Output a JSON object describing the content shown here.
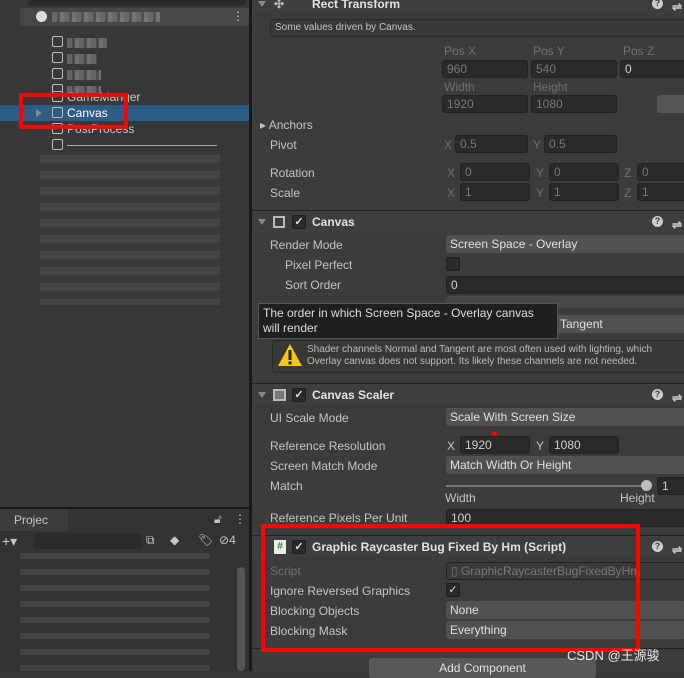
{
  "hierarchy": {
    "items": [
      {
        "label": "GameManger"
      },
      {
        "label": "Canvas",
        "selected": true
      },
      {
        "label": "PostProcess"
      }
    ],
    "menu_icon": "kebab-icon"
  },
  "project": {
    "tab_label": "Projec",
    "hidden_count": "4"
  },
  "inspector": {
    "rect_transform": {
      "title": "Rect Transform",
      "note": "Some values driven by Canvas.",
      "pos_x_label": "Pos X",
      "pos_y_label": "Pos Y",
      "pos_z_label": "Pos Z",
      "pos_x": "960",
      "pos_y": "540",
      "pos_z": "0",
      "width_label": "Width",
      "height_label": "Height",
      "width": "1920",
      "height": "1080",
      "anchors_label": "Anchors",
      "pivot_label": "Pivot",
      "pivot_x": "0.5",
      "pivot_y": "0.5",
      "rotation_label": "Rotation",
      "rot_x": "0",
      "rot_y": "0",
      "rot_z": "0",
      "scale_label": "Scale",
      "scale_x": "1",
      "scale_y": "1",
      "scale_z": "1",
      "axis_x": "X",
      "axis_y": "Y",
      "axis_z": "Z"
    },
    "canvas": {
      "title": "Canvas",
      "enabled": true,
      "render_mode_label": "Render Mode",
      "render_mode": "Screen Space - Overlay",
      "pixel_perfect_label": "Pixel Perfect",
      "pixel_perfect": false,
      "sort_order_label": "Sort Order",
      "sort_order": "0",
      "shader_channels_value": "Tangent",
      "tooltip": "The order in which Screen Space - Overlay canvas will render",
      "warning": "Shader channels Normal and Tangent are most often used with lighting, which Overlay canvas does not support. Its likely these channels are not needed."
    },
    "canvas_scaler": {
      "title": "Canvas Scaler",
      "enabled": true,
      "ui_scale_mode_label": "UI Scale Mode",
      "ui_scale_mode": "Scale With Screen Size",
      "ref_res_label": "Reference Resolution",
      "ref_x": "1920",
      "ref_y": "1080",
      "match_mode_label": "Screen Match Mode",
      "match_mode": "Match Width Or Height",
      "match_label": "Match",
      "match_value": "1",
      "match_fraction": 1,
      "match_min_label": "Width",
      "match_max_label": "Height",
      "ppu_label": "Reference Pixels Per Unit",
      "ppu": "100"
    },
    "raycaster": {
      "title": "Graphic Raycaster Bug Fixed By Hm (Script)",
      "enabled": true,
      "script_label": "Script",
      "script": "GraphicRaycasterBugFixedByHm",
      "ignore_reversed_label": "Ignore Reversed Graphics",
      "ignore_reversed": true,
      "blocking_objects_label": "Blocking Objects",
      "blocking_objects": "None",
      "blocking_mask_label": "Blocking Mask",
      "blocking_mask": "Everything"
    },
    "add_component": "Add Component"
  },
  "watermark": "CSDN @王源骏",
  "colors": {
    "selection": "#2c5d87",
    "highlight": "#ff0000",
    "warning": "#f5c518"
  }
}
